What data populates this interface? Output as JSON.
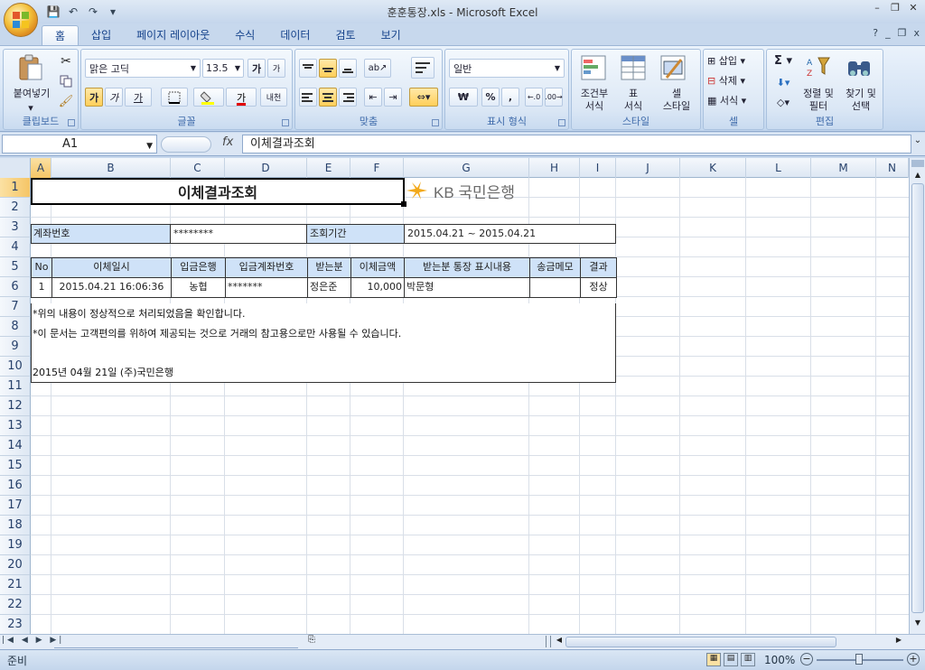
{
  "window": {
    "title": "훈훈통장.xls - Microsoft Excel",
    "minimize": "–",
    "restore": "❐",
    "close": "✕"
  },
  "office_button": {
    "label": "오피스"
  },
  "qat": {
    "save": "💾",
    "undo": "↶",
    "redo": "↷",
    "customize": "▾"
  },
  "tabs": [
    {
      "label": "홈",
      "active": true
    },
    {
      "label": "삽입"
    },
    {
      "label": "페이지 레이아웃"
    },
    {
      "label": "수식"
    },
    {
      "label": "데이터"
    },
    {
      "label": "검토"
    },
    {
      "label": "보기"
    }
  ],
  "ribbon": {
    "clipboard": {
      "label": "클립보드",
      "paste": "붙여넣기"
    },
    "font": {
      "label": "글꼴",
      "name": "맑은 고딕",
      "size": "13.5",
      "bold": "가",
      "italic": "가",
      "underline": "가",
      "font_color": "가",
      "grow": "가",
      "shrink": "가",
      "phonetic": "내천"
    },
    "alignment": {
      "label": "맞춤"
    },
    "number": {
      "label": "표시 형식",
      "format": "일반",
      "currency": "₩",
      "percent": "%",
      "comma": ","
    },
    "styles": {
      "label": "스타일",
      "conditional": "조건부\n서식",
      "table": "표\n서식",
      "cell": "셀\n스타일"
    },
    "cells": {
      "label": "셀",
      "insert": "삽입",
      "delete": "삭제",
      "format": "서식"
    },
    "editing": {
      "label": "편집",
      "sort": "정렬 및\n필터",
      "find": "찾기 및\n선택"
    }
  },
  "formula_bar": {
    "name_box": "A1",
    "fx": "fx",
    "content": "이체결과조회"
  },
  "columns": [
    "A",
    "B",
    "C",
    "D",
    "E",
    "F",
    "G",
    "H",
    "I",
    "J",
    "K",
    "L",
    "M",
    "N"
  ],
  "rows": [
    "1",
    "2",
    "3",
    "4",
    "5",
    "6",
    "7",
    "8",
    "9",
    "10",
    "11",
    "12",
    "13",
    "14",
    "15",
    "16",
    "17",
    "18",
    "19",
    "20",
    "21",
    "22",
    "23"
  ],
  "sheet": {
    "title": "이체결과조회",
    "logo_text": "KB 국민은행",
    "account_label": "계좌번호",
    "account_value": "********",
    "period_label": "조회기간",
    "period_value": "2015.04.21 ~ 2015.04.21",
    "table_headers": [
      "No",
      "이체일시",
      "입금은행",
      "입금계좌번호",
      "받는분",
      "이체금액",
      "받는분 통장 표시내용",
      "송금메모",
      "결과"
    ],
    "table_rows": [
      [
        "1",
        "2015.04.21 16:06:36",
        "농협",
        "*******",
        "정은준",
        "10,000",
        "박문형",
        "",
        "정상"
      ]
    ],
    "note1": "*위의 내용이 정상적으로 처리되었음을 확인합니다.",
    "note2": "*이 문서는 고객편의를 위하여 제공되는 것으로 거래의 참고용으로만 사용될 수 있습니다.",
    "footer": "2015년 04월 21일 (주)국민은행"
  },
  "status": {
    "ready": "준비",
    "zoom": "100%"
  },
  "colors": {
    "header_fill": "#cfe2f8",
    "kb_yellow": "#f2a91a",
    "kb_gray": "#6b6b6b"
  }
}
